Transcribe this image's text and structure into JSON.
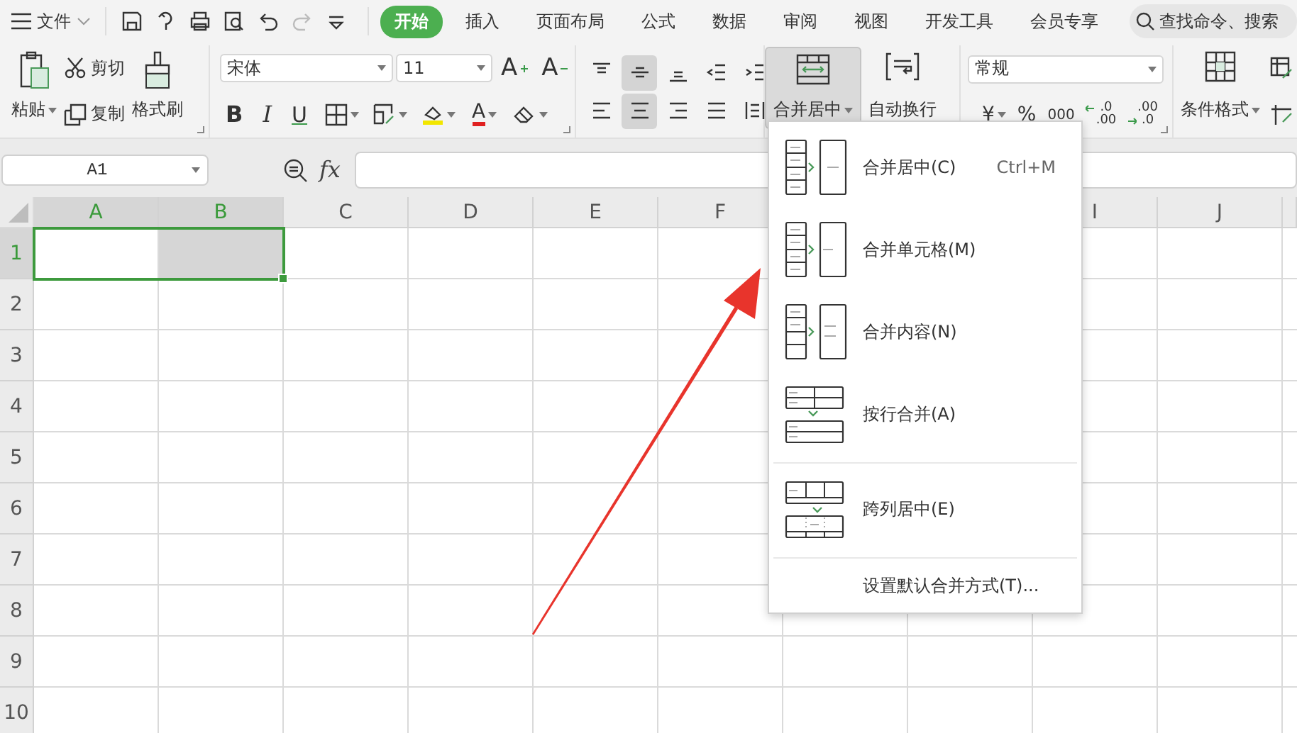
{
  "top_bar": {
    "file_menu": "文件",
    "tabs": [
      {
        "label": "开始",
        "selected": true
      },
      {
        "label": "插入",
        "selected": false
      },
      {
        "label": "页面布局",
        "selected": false
      },
      {
        "label": "公式",
        "selected": false
      },
      {
        "label": "数据",
        "selected": false
      },
      {
        "label": "审阅",
        "selected": false
      },
      {
        "label": "视图",
        "selected": false
      },
      {
        "label": "开发工具",
        "selected": false
      },
      {
        "label": "会员专享",
        "selected": false
      }
    ],
    "search": {
      "placeholder": "查找命令、搜索"
    }
  },
  "ribbon": {
    "clipboard": {
      "paste": "粘贴",
      "cut": "剪切",
      "copy": "复制",
      "format_painter": "格式刷"
    },
    "font": {
      "name": "宋体",
      "size": "11",
      "grow": "A",
      "shrink": "A",
      "bold": "B",
      "italic": "I",
      "underline": "U",
      "font_color": "A"
    },
    "alignment": [
      {
        "kind": "top",
        "selected": false
      },
      {
        "kind": "middle",
        "selected": true
      },
      {
        "kind": "bottom",
        "selected": false
      },
      {
        "kind": "outdent",
        "selected": false
      },
      {
        "kind": "indent",
        "selected": false
      },
      {
        "kind": "left",
        "selected": false
      },
      {
        "kind": "center",
        "selected": true
      },
      {
        "kind": "right",
        "selected": false
      },
      {
        "kind": "justify",
        "selected": false
      },
      {
        "kind": "distributed",
        "selected": false
      }
    ],
    "merge": {
      "label": "合并居中",
      "expanded": true
    },
    "wrap": "自动换行",
    "number": {
      "format": "常规",
      "currency": "¥",
      "percent": "%",
      "thousands": "000",
      "increase_decimal": [
        ".0",
        ".00"
      ],
      "decrease_decimal": [
        ".00",
        ".0"
      ]
    },
    "conditional_format": "条件格式"
  },
  "formula_bar": {
    "name_box": "A1",
    "fx": "fx"
  },
  "sheet": {
    "columns": [
      {
        "label": "A",
        "selected": true
      },
      {
        "label": "B",
        "selected": true
      },
      {
        "label": "C",
        "selected": false
      },
      {
        "label": "D",
        "selected": false
      },
      {
        "label": "E",
        "selected": false
      },
      {
        "label": "F",
        "selected": false
      }
    ],
    "columns_past_menu": [
      {
        "label": "I",
        "selected": false
      },
      {
        "label": "J",
        "selected": false
      }
    ],
    "rows": [
      {
        "label": "1",
        "selected": true
      },
      {
        "label": "2",
        "selected": false
      },
      {
        "label": "3",
        "selected": false
      },
      {
        "label": "4",
        "selected": false
      },
      {
        "label": "5",
        "selected": false
      },
      {
        "label": "6",
        "selected": false
      },
      {
        "label": "7",
        "selected": false
      },
      {
        "label": "8",
        "selected": false
      },
      {
        "label": "9",
        "selected": false
      },
      {
        "label": "10",
        "selected": false
      }
    ]
  },
  "merge_menu": {
    "items": [
      {
        "kind": "merge-center",
        "label": "合并居中(C)",
        "shortcut": "Ctrl+M"
      },
      {
        "kind": "merge-cells",
        "label": "合并单元格(M)"
      },
      {
        "kind": "merge-content",
        "label": "合并内容(N)"
      },
      {
        "kind": "merge-rows",
        "label": "按行合并(A)"
      },
      {
        "kind": "center-across",
        "label": "跨列居中(E)"
      },
      {
        "kind": "settings",
        "label": "设置默认合并方式(T)..."
      }
    ]
  }
}
